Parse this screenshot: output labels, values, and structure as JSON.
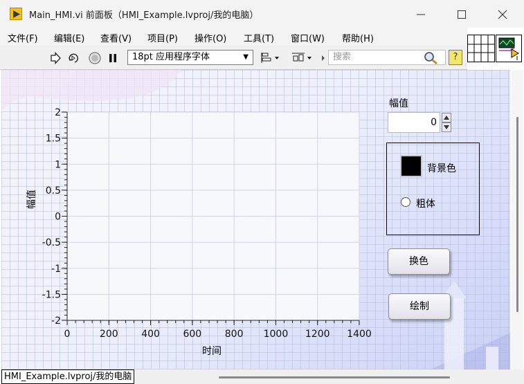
{
  "window": {
    "title": "Main_HMI.vi 前面板（HMI_Example.lvproj/我的电脑）",
    "controls": [
      "minimize-icon",
      "maximize-icon",
      "close-icon"
    ]
  },
  "menu": {
    "items": [
      "文件(F)",
      "编辑(E)",
      "查看(V)",
      "项目(P)",
      "操作(O)",
      "工具(T)",
      "窗口(W)",
      "帮助(H)"
    ]
  },
  "toolbar": {
    "icons": [
      "run-arrow-icon",
      "run-continuously-icon",
      "abort-icon",
      "pause-icon",
      "align-icon",
      "distribute-icon"
    ],
    "font_setting": "18pt 应用程序字体",
    "search_placeholder": "搜索",
    "help_label": "?"
  },
  "graph": {
    "ylabel": "幅值",
    "xlabel": "时间",
    "plot_bg": "#f7f8fb",
    "grid_color": "#cfd2f0",
    "axis_color": "#222222"
  },
  "chart_data": {
    "type": "line",
    "xlim": [
      0,
      1400
    ],
    "ylim": [
      -2,
      2
    ],
    "x_ticks": [
      "0",
      "200",
      "400",
      "600",
      "800",
      "1000",
      "1200",
      "1400"
    ],
    "y_ticks": [
      "2",
      "1.5",
      "1",
      "0.5",
      "0",
      "-0.5",
      "-1",
      "-1.5",
      "-2"
    ],
    "xlabel": "时间",
    "ylabel": "幅值",
    "series": [],
    "grid": true
  },
  "amplitude": {
    "label": "幅值",
    "value": "0"
  },
  "options": {
    "bg_color_label": "背景色",
    "bg_color_value": "#000000",
    "bold_label": "粗体",
    "bold_checked": false
  },
  "buttons": {
    "change_color": "换色",
    "draw": "绘制"
  },
  "status": {
    "path": "HMI_Example.lvproj/我的电脑"
  }
}
